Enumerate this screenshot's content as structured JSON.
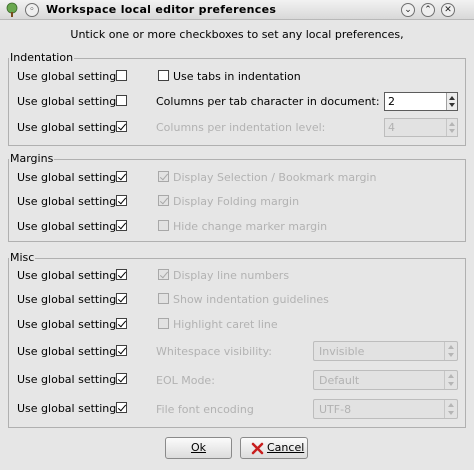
{
  "window": {
    "title": "Workspace local editor preferences",
    "instruction": "Untick one or more checkboxes to set any local preferences,"
  },
  "indentation": {
    "legend": "Indentation",
    "rows": [
      {
        "global_label": "Use global setting",
        "global_checked": false,
        "option_label": "Use tabs in indentation",
        "option_checked": false
      },
      {
        "global_label": "Use global setting",
        "global_checked": false,
        "option_label": "Columns per tab character in document:",
        "value": "2"
      },
      {
        "global_label": "Use global setting",
        "global_checked": true,
        "option_label": "Columns per indentation level:",
        "value": "4"
      }
    ]
  },
  "margins": {
    "legend": "Margins",
    "rows": [
      {
        "global_label": "Use global setting",
        "global_checked": true,
        "option_label": "Display Selection / Bookmark margin",
        "option_checked": true
      },
      {
        "global_label": "Use global setting",
        "global_checked": true,
        "option_label": "Display Folding margin",
        "option_checked": true
      },
      {
        "global_label": "Use global setting",
        "global_checked": true,
        "option_label": "Hide change marker margin",
        "option_checked": false
      }
    ]
  },
  "misc": {
    "legend": "Misc",
    "rows": [
      {
        "global_label": "Use global setting",
        "global_checked": true,
        "option_label": "Display line numbers",
        "option_checked": true
      },
      {
        "global_label": "Use global setting",
        "global_checked": true,
        "option_label": "Show indentation guidelines",
        "option_checked": false
      },
      {
        "global_label": "Use global setting",
        "global_checked": true,
        "option_label": "Highlight caret line",
        "option_checked": false
      },
      {
        "global_label": "Use global setting",
        "global_checked": true,
        "option_label": "Whitespace visibility:",
        "value": "Invisible"
      },
      {
        "global_label": "Use global setting",
        "global_checked": true,
        "option_label": "EOL Mode:",
        "value": "Default"
      },
      {
        "global_label": "Use global setting",
        "global_checked": true,
        "option_label": "File font encoding",
        "value": "UTF-8"
      }
    ]
  },
  "buttons": {
    "ok_label": "Ok",
    "cancel_label": "Cancel"
  },
  "colors": {
    "background": "#e6e6e6",
    "disabled_text": "#b2b2b2",
    "cancel_icon": "#c81e1e",
    "ok_icon": "#2e8b2e"
  },
  "icons": {
    "app": "tree-icon",
    "menu": "window-menu-icon",
    "minimize": "minimize-icon",
    "close": "close-icon",
    "ok": "checkmark-icon",
    "cancel": "cancel-icon"
  }
}
